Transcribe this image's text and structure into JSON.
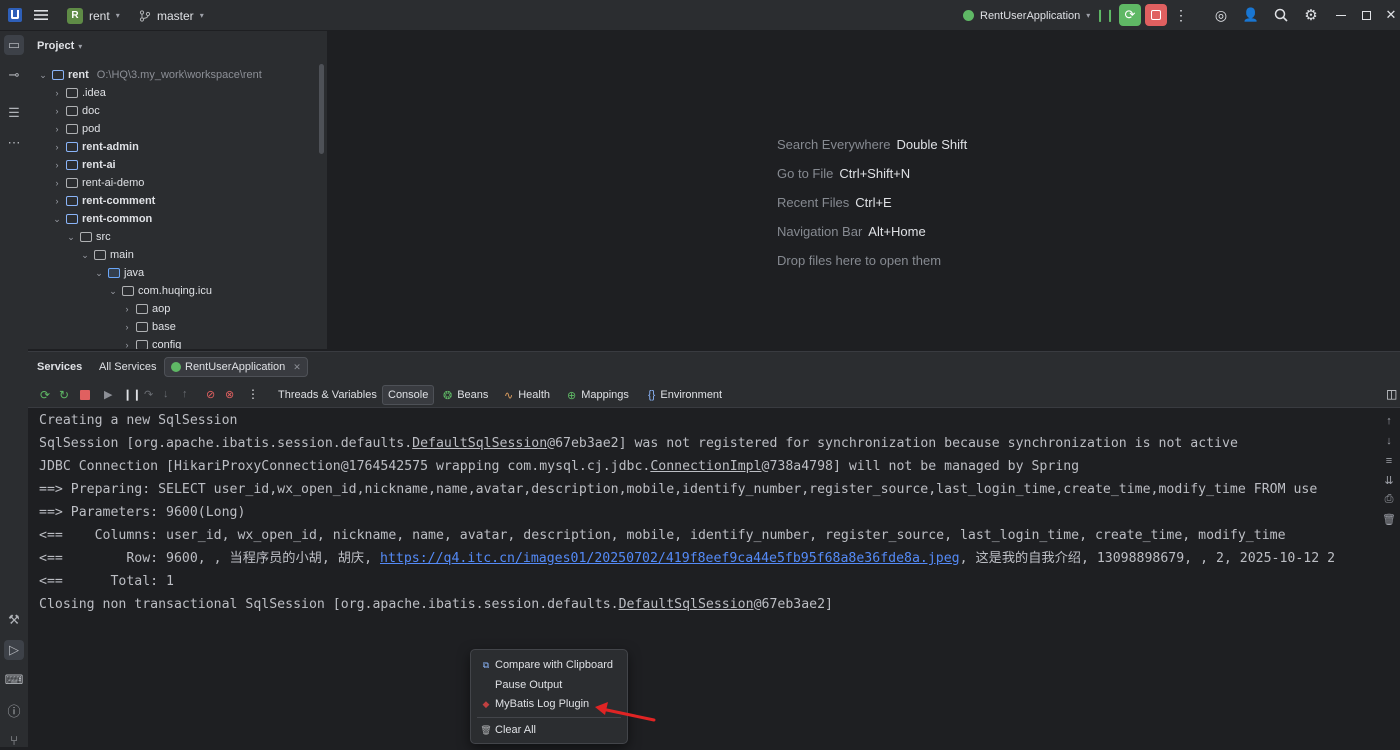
{
  "titlebar": {
    "project_badge": "R",
    "project_name": "rent",
    "branch": "master",
    "run_config": "RentUserApplication"
  },
  "project_panel": {
    "title": "Project",
    "root": {
      "name": "rent",
      "path": "O:\\HQ\\3.my_work\\workspace\\rent"
    },
    "items": [
      {
        "label": ".idea"
      },
      {
        "label": "doc"
      },
      {
        "label": "pod"
      },
      {
        "label": "rent-admin"
      },
      {
        "label": "rent-ai"
      },
      {
        "label": "rent-ai-demo"
      },
      {
        "label": "rent-comment"
      },
      {
        "label": "rent-common"
      },
      {
        "label": "src"
      },
      {
        "label": "main"
      },
      {
        "label": "java"
      },
      {
        "label": "com.huqing.icu"
      },
      {
        "label": "aop"
      },
      {
        "label": "base"
      },
      {
        "label": "config"
      }
    ]
  },
  "editor_hints": [
    {
      "label": "Search Everywhere",
      "shortcut": "Double Shift"
    },
    {
      "label": "Go to File",
      "shortcut": "Ctrl+Shift+N"
    },
    {
      "label": "Recent Files",
      "shortcut": "Ctrl+E"
    },
    {
      "label": "Navigation Bar",
      "shortcut": "Alt+Home"
    },
    {
      "label": "Drop files here to open them",
      "shortcut": ""
    }
  ],
  "services": {
    "title": "Services",
    "tabs": [
      "All Services",
      "RentUserApplication"
    ],
    "subtabs": [
      "Threads & Variables",
      "Console",
      "Beans",
      "Health",
      "Mappings",
      "Environment"
    ]
  },
  "console": {
    "lines": [
      {
        "text": "Creating a new SqlSession"
      },
      {
        "pre": "SqlSession [org.apache.ibatis.session.defaults.",
        "ul": "DefaultSqlSession",
        "post": "@67eb3ae2] was not registered for synchronization because synchronization is not active"
      },
      {
        "pre": "JDBC Connection [HikariProxyConnection@1764542575 wrapping com.mysql.cj.jdbc.",
        "ul": "ConnectionImpl",
        "post": "@738a4798] will not be managed by Spring"
      },
      {
        "text": "==>  Preparing: SELECT user_id,wx_open_id,nickname,name,avatar,description,mobile,identify_number,register_source,last_login_time,create_time,modify_time FROM use"
      },
      {
        "text": "==> Parameters: 9600(Long)"
      },
      {
        "text": "<==    Columns: user_id, wx_open_id, nickname, name, avatar, description, mobile, identify_number, register_source, last_login_time, create_time, modify_time"
      },
      {
        "pre": "<==        Row: 9600, , 当程序员的小胡, 胡庆, ",
        "link": "https://q4.itc.cn/images01/20250702/419f8eef9ca44e5fb95f68a8e36fde8a.jpeg",
        "post": ", 这是我的自我介绍, 13098898679, , 2, 2025-10-12 2"
      },
      {
        "text": "<==      Total: 1"
      },
      {
        "pre": "Closing non transactional SqlSession [org.apache.ibatis.session.defaults.",
        "ul": "DefaultSqlSession",
        "post": "@67eb3ae2]"
      }
    ]
  },
  "context_menu": {
    "items": [
      "Compare with Clipboard",
      "Pause Output",
      "MyBatis Log Plugin",
      "Clear All"
    ]
  },
  "colors": {
    "accent": "#548af7",
    "run_green": "#5fb865",
    "stop_red": "#e06060",
    "arrow_red": "#e02424"
  }
}
